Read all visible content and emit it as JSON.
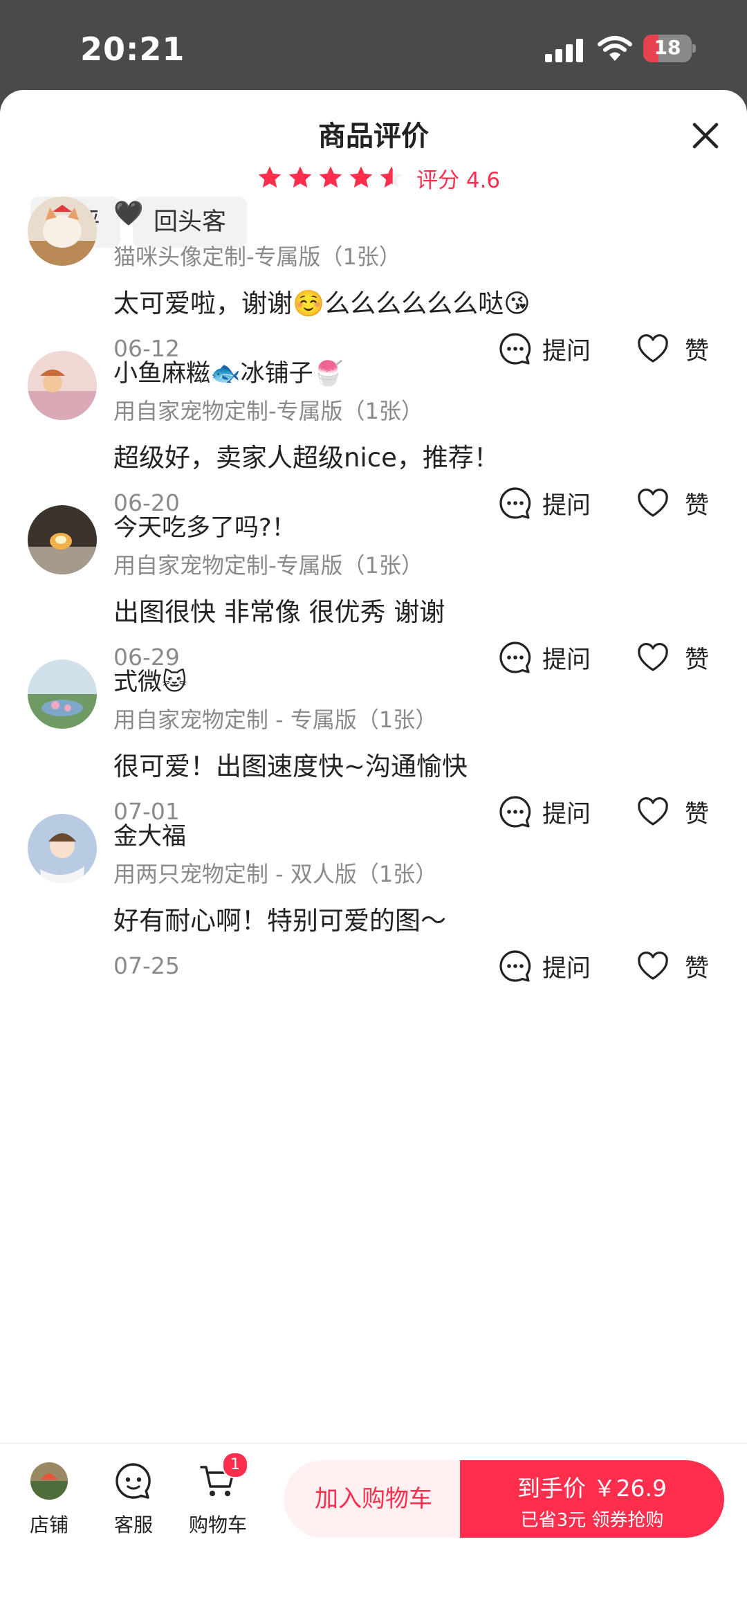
{
  "status": {
    "time": "20:21",
    "battery": "18"
  },
  "sheet": {
    "title": "商品评价",
    "rating": {
      "stars": 4.6,
      "label": "评分 4.6"
    },
    "chips": [
      "好评",
      "回头客"
    ]
  },
  "reviews": [
    {
      "name": "🖤",
      "variant": "猫咪头像定制-专属版（1张）",
      "text": "太可爱啦，谢谢☺️么么么么么么哒😘",
      "date": "06-12",
      "ask": "提问",
      "like": "赞"
    },
    {
      "name": "小鱼麻糍🐟冰铺子🍧",
      "variant": "用自家宠物定制-专属版（1张）",
      "text": "超级好，卖家人超级nice，推荐！",
      "date": "06-20",
      "ask": "提问",
      "like": "赞"
    },
    {
      "name": "今天吃多了吗?！",
      "variant": "用自家宠物定制-专属版（1张）",
      "text": "出图很快 非常像 很优秀 谢谢",
      "date": "06-29",
      "ask": "提问",
      "like": "赞"
    },
    {
      "name": "式微🐱",
      "variant": "用自家宠物定制 - 专属版（1张）",
      "text": "很可爱！出图速度快~沟通愉快",
      "date": "07-01",
      "ask": "提问",
      "like": "赞"
    },
    {
      "name": "金大福",
      "variant": "用两只宠物定制 - 双人版（1张）",
      "text": "好有耐心啊！特别可爱的图～",
      "date": "07-25",
      "ask": "提问",
      "like": "赞"
    }
  ],
  "bottom": {
    "shop": "店铺",
    "service": "客服",
    "cart": "购物车",
    "cart_count": "1",
    "add_to_cart": "加入购物车",
    "buy_main": "到手价 ￥26.9",
    "buy_sub": "已省3元 领券抢购"
  },
  "colors": {
    "accent": "#ff2e4d",
    "accent_light": "#fff0f2",
    "muted_text": "#8a8a8a"
  }
}
